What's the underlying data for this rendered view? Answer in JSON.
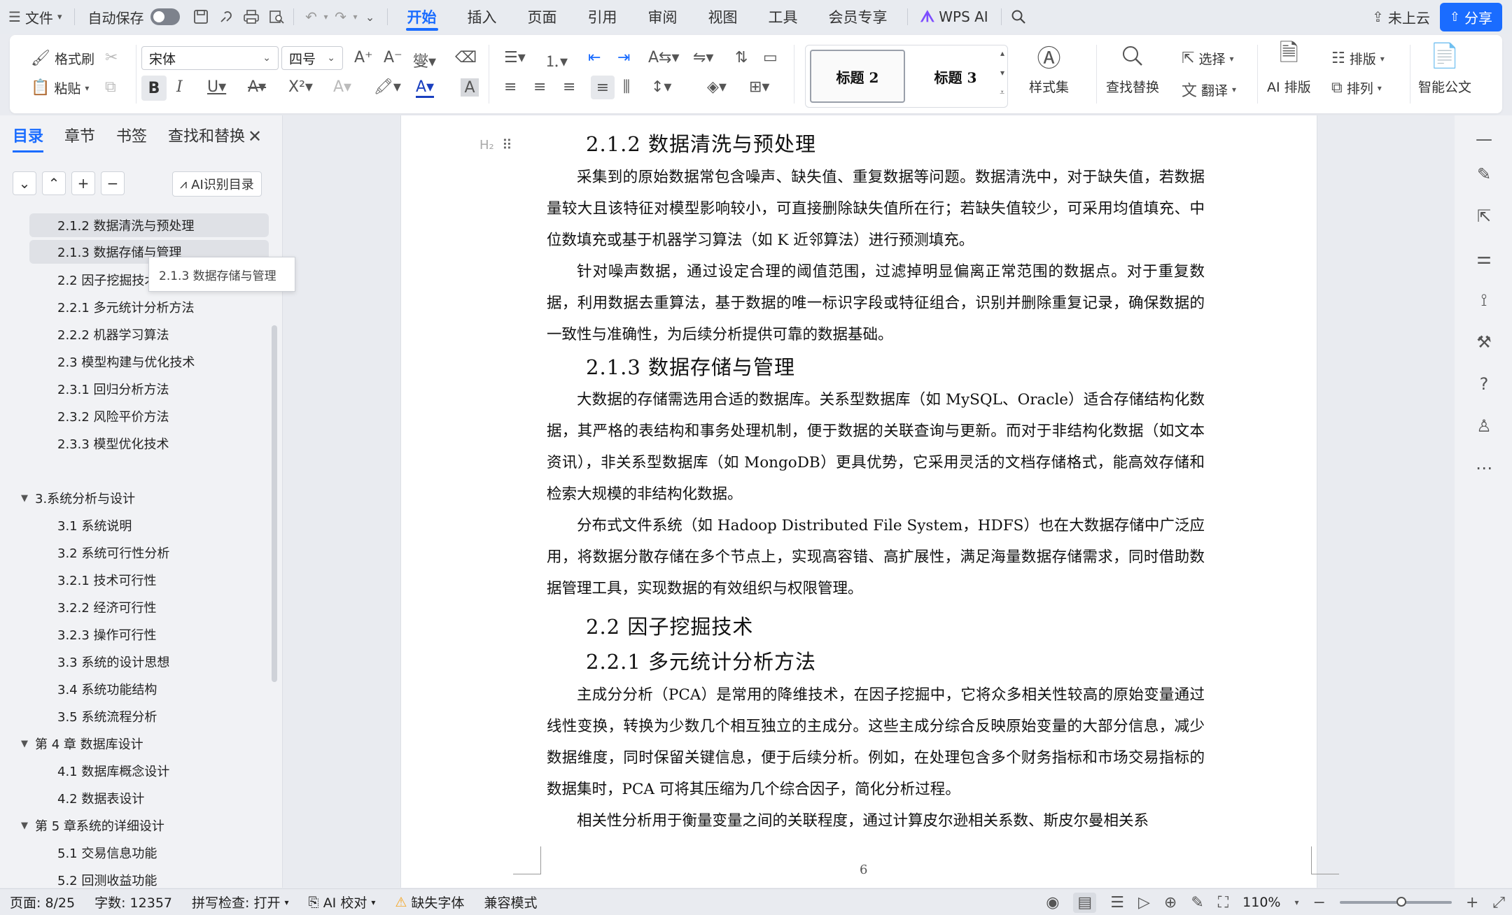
{
  "menubar": {
    "file": "文件",
    "autosave": "自动保存",
    "tabs": [
      "开始",
      "插入",
      "页面",
      "引用",
      "审阅",
      "视图",
      "工具",
      "会员专享"
    ],
    "active_tab": "开始",
    "wps_ai": "WPS AI",
    "cloud": "未上云",
    "share": "分享"
  },
  "ribbon": {
    "format_painter": "格式刷",
    "paste": "粘贴",
    "font_name": "宋体",
    "font_size": "四号",
    "style_h2": "标题 2",
    "style_h3": "标题 3",
    "style_set": "样式集",
    "find_replace": "查找替换",
    "select": "选择",
    "translate": "翻译",
    "ai_layout": "AI 排版",
    "layout": "排版",
    "arrange": "排列",
    "smart_doc": "智能公文"
  },
  "nav": {
    "tabs": [
      "目录",
      "章节",
      "书签",
      "查找和替换"
    ],
    "active_tab": "目录",
    "ai_toc": "AI识别目录",
    "tooltip": "2.1.3 数据存储与管理",
    "items": [
      {
        "label": "2.1.2 数据清洗与预处理",
        "level": "lv3"
      },
      {
        "label": "2.1.3 数据存储与管理",
        "level": "lv3"
      },
      {
        "label": "2.2 因子挖掘技术",
        "level": "lv2"
      },
      {
        "label": "2.2.1 多元统计分析方法",
        "level": "lv3"
      },
      {
        "label": "2.2.2 机器学习算法",
        "level": "lv3"
      },
      {
        "label": "2.3 模型构建与优化技术",
        "level": "lv2"
      },
      {
        "label": "2.3.1 回归分析方法",
        "level": "lv3"
      },
      {
        "label": "2.3.2 风险平价方法",
        "level": "lv3"
      },
      {
        "label": "2.3.3 模型优化技术",
        "level": "lv3"
      },
      {
        "label": "3.系统分析与设计",
        "level": "lv1"
      },
      {
        "label": "3.1 系统说明",
        "level": "lv2"
      },
      {
        "label": "3.2 系统可行性分析",
        "level": "lv2"
      },
      {
        "label": "3.2.1 技术可行性",
        "level": "lv3"
      },
      {
        "label": "3.2.2 经济可行性",
        "level": "lv3"
      },
      {
        "label": "3.2.3 操作可行性",
        "level": "lv3"
      },
      {
        "label": "3.3 系统的设计思想",
        "level": "lv2"
      },
      {
        "label": "3.4 系统功能结构",
        "level": "lv2"
      },
      {
        "label": "3.5 系统流程分析",
        "level": "lv2"
      },
      {
        "label": "第 4 章 数据库设计",
        "level": "lv1"
      },
      {
        "label": "4.1 数据库概念设计",
        "level": "lv2"
      },
      {
        "label": "4.2 数据表设计",
        "level": "lv2"
      },
      {
        "label": "第 5 章系统的详细设计",
        "level": "lv1"
      },
      {
        "label": "5.1 交易信息功能",
        "level": "lv2"
      },
      {
        "label": "5.2 回测收益功能",
        "level": "lv2"
      }
    ]
  },
  "doc": {
    "h_212": "2.1.2 数据清洗与预处理",
    "p1": "采集到的原始数据常包含噪声、缺失值、重复数据等问题。数据清洗中，对于缺失值，若数据量较大且该特征对模型影响较小，可直接删除缺失值所在行；若缺失值较少，可采用均值填充、中位数填充或基于机器学习算法（如 K 近邻算法）进行预测填充。",
    "p2": "针对噪声数据，通过设定合理的阈值范围，过滤掉明显偏离正常范围的数据点。对于重复数据，利用数据去重算法，基于数据的唯一标识字段或特征组合，识别并删除重复记录，确保数据的一致性与准确性，为后续分析提供可靠的数据基础。",
    "h_213": "2.1.3 数据存储与管理",
    "p3": "大数据的存储需选用合适的数据库。关系型数据库（如 MySQL、Oracle）适合存储结构化数据，其严格的表结构和事务处理机制，便于数据的关联查询与更新。而对于非结构化数据（如文本资讯），非关系型数据库（如 MongoDB）更具优势，它采用灵活的文档存储格式，能高效存储和检索大规模的非结构化数据。",
    "p4": "分布式文件系统（如 Hadoop Distributed File System，HDFS）也在大数据存储中广泛应用，将数据分散存储在多个节点上，实现高容错、高扩展性，满足海量数据存储需求，同时借助数据管理工具，实现数据的有效组织与权限管理。",
    "h_22": "2.2 因子挖掘技术",
    "h_221": "2.2.1 多元统计分析方法",
    "p5": "主成分分析（PCA）是常用的降维技术，在因子挖掘中，它将众多相关性较高的原始变量通过线性变换，转换为少数几个相互独立的主成分。这些主成分综合反映原始变量的大部分信息，减少数据维度，同时保留关键信息，便于后续分析。例如，在处理包含多个财务指标和市场交易指标的数据集时，PCA 可将其压缩为几个综合因子，简化分析过程。",
    "p6": "相关性分析用于衡量变量之间的关联程度，通过计算皮尔逊相关系数、斯皮尔曼相关系",
    "page_number": "6"
  },
  "status": {
    "page": "页面: 8/25",
    "words": "字数: 12357",
    "spell": "拼写检查: 打开",
    "ai_check": "AI 校对",
    "missing_font": "缺失字体",
    "compat": "兼容模式",
    "zoom": "110%",
    "zoom_level": 0.55
  },
  "colors": {
    "accent": "#1a6cff",
    "ai": "#7d4dff",
    "warn": "#f5a623"
  }
}
